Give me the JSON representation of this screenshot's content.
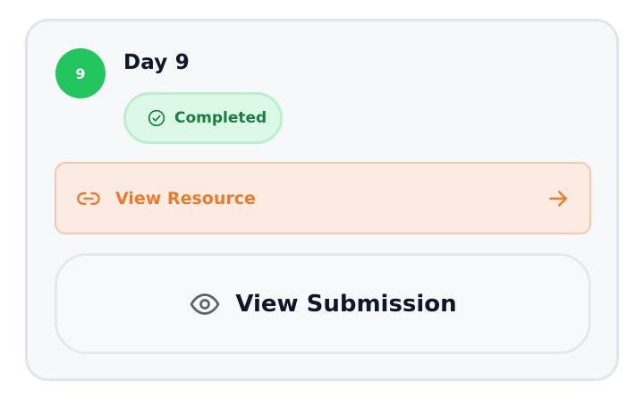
{
  "day": {
    "badge_number": "9",
    "title": "Day 9"
  },
  "status": {
    "label": "Completed",
    "icon": "check-circle-icon",
    "color": "#16803c"
  },
  "resource": {
    "label": "View Resource",
    "icon": "link-icon",
    "trailing_icon": "arrow-right-icon",
    "color": "#ea7c2c"
  },
  "submission": {
    "label": "View Submission",
    "icon": "eye-icon"
  },
  "colors": {
    "badge": "#22c55e",
    "card_bg": "#f7f8fa",
    "text_primary": "#0f1729"
  }
}
